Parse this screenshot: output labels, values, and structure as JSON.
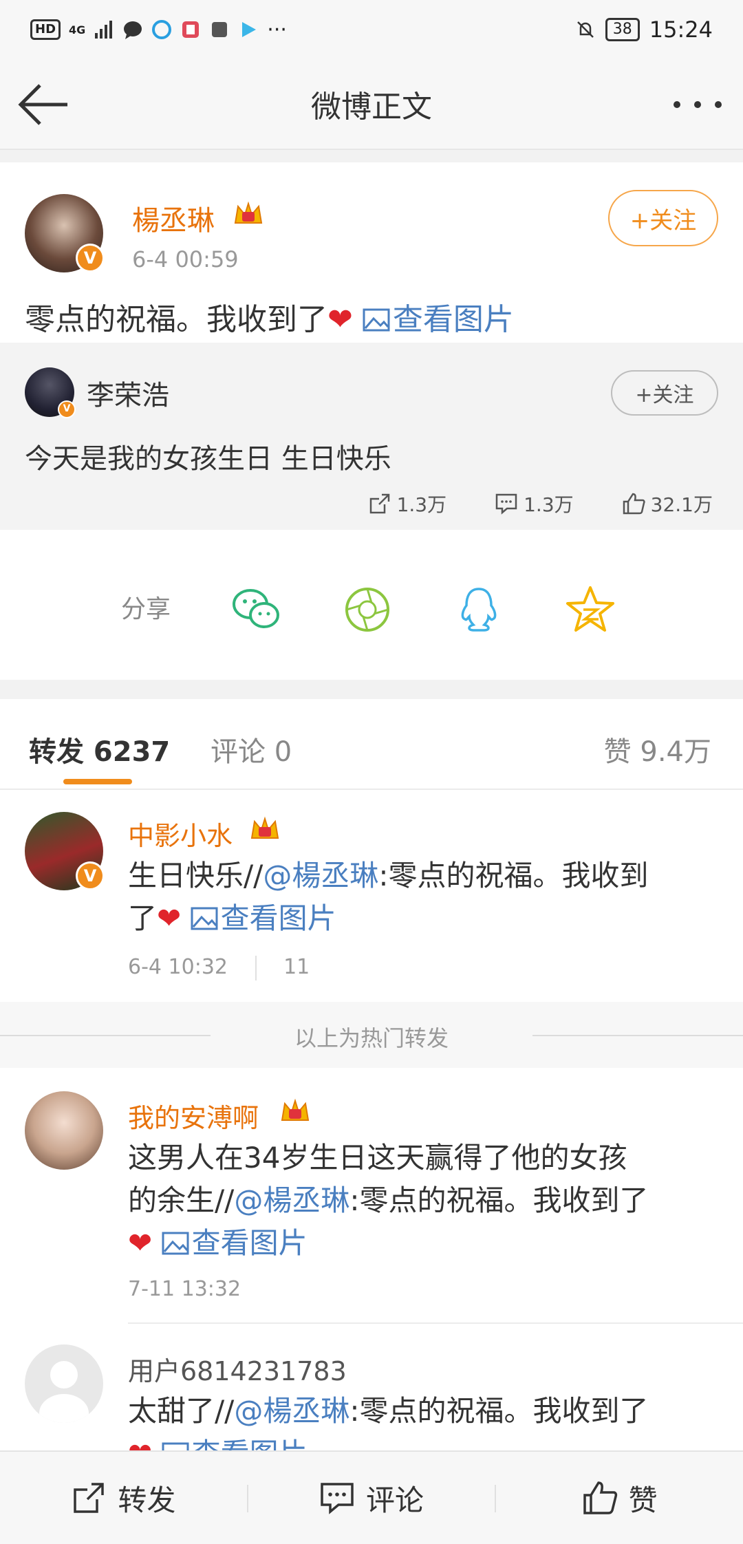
{
  "status_bar": {
    "hd": "HD",
    "network": "4G",
    "battery": "38",
    "time": "15:24"
  },
  "nav": {
    "title": "微博正文"
  },
  "post": {
    "author": "楊丞琳",
    "time": "6-4 00:59",
    "follow_label": "+关注",
    "text": "零点的祝福。我收到了",
    "view_pic": "查看图片",
    "original": {
      "author": "李荣浩",
      "follow_label": "+关注",
      "text": "今天是我的女孩生日 生日快乐",
      "reposts": "1.3万",
      "comments": "1.3万",
      "likes": "32.1万"
    }
  },
  "share": {
    "label": "分享",
    "targets": [
      "wechat-icon",
      "moments-icon",
      "qq-icon",
      "qzone-icon"
    ]
  },
  "tabs": {
    "repost": "转发 6237",
    "comment": "评论 0",
    "like": "赞 9.4万"
  },
  "reposts": [
    {
      "author": "中影小水",
      "text_prefix": "生日快乐//",
      "mention": "@楊丞琳",
      "text_line1_rest": ":零点的祝福。我收到",
      "text_line2": "了",
      "view_pic": "查看图片",
      "time": "6-4 10:32",
      "count": "11"
    },
    {
      "author": "我的安溥啊",
      "line1": "这男人在34岁生日这天赢得了他的女孩",
      "line2_prefix": "的余生//",
      "mention": "@楊丞琳",
      "line2_rest": ":零点的祝福。我收到了",
      "view_pic": "查看图片",
      "time": "7-11 13:32"
    },
    {
      "author": "用户6814231783",
      "line1_prefix": "太甜了//",
      "mention": "@楊丞琳",
      "line1_rest": ":零点的祝福。我收到了",
      "view_pic": "查看图片"
    }
  ],
  "hot_divider": "以上为热门转发",
  "bottom_bar": {
    "repost": "转发",
    "comment": "评论",
    "like": "赞"
  }
}
